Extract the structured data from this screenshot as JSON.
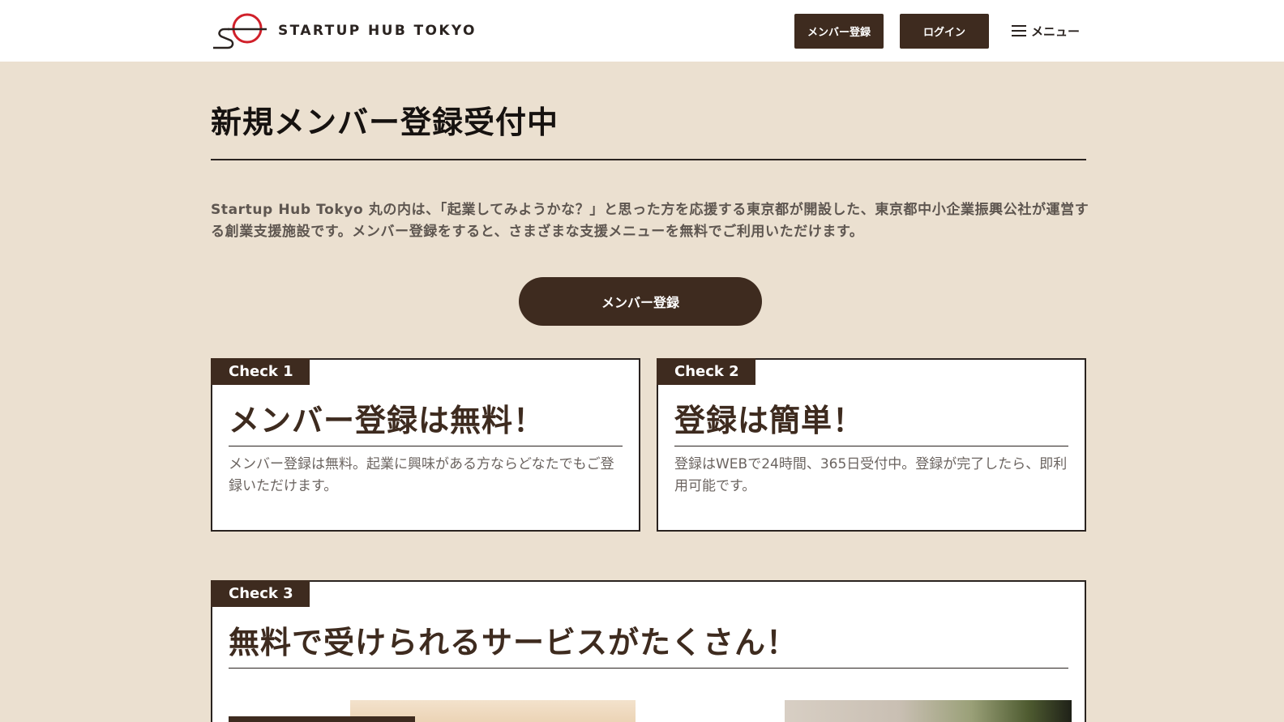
{
  "header": {
    "logo_text": "STARTUP HUB TOKYO",
    "member_button": "メンバー登録",
    "login_button": "ログイン",
    "menu_label": "メニュー"
  },
  "main": {
    "title": "新規メンバー登録受付中",
    "intro": "Startup Hub Tokyo 丸の内は、「起業してみようかな？」と思った方を応援する東京都が開設した、東京都中小企業振興公社が運営する創業支援施設です。メンバー登録をすると、さまざまな支援メニューを無料でご利用いただけます。",
    "cta": "メンバー登録"
  },
  "checks": [
    {
      "tag": "Check 1",
      "title": "メンバー登録は無料！",
      "body": "メンバー登録は無料。起業に興味がある方ならどなたでもご登録いただけます。"
    },
    {
      "tag": "Check 2",
      "title": "登録は簡単！",
      "body": "登録はWEBで24時間、365日受付中。登録が完了したら、即利用可能です。"
    },
    {
      "tag": "Check 3",
      "title": "無料で受けられるサービスがたくさん！"
    }
  ],
  "colors": {
    "background": "#ebe0d0",
    "brand_brown": "#3e2b1f",
    "logo_red": "#d0202a"
  }
}
